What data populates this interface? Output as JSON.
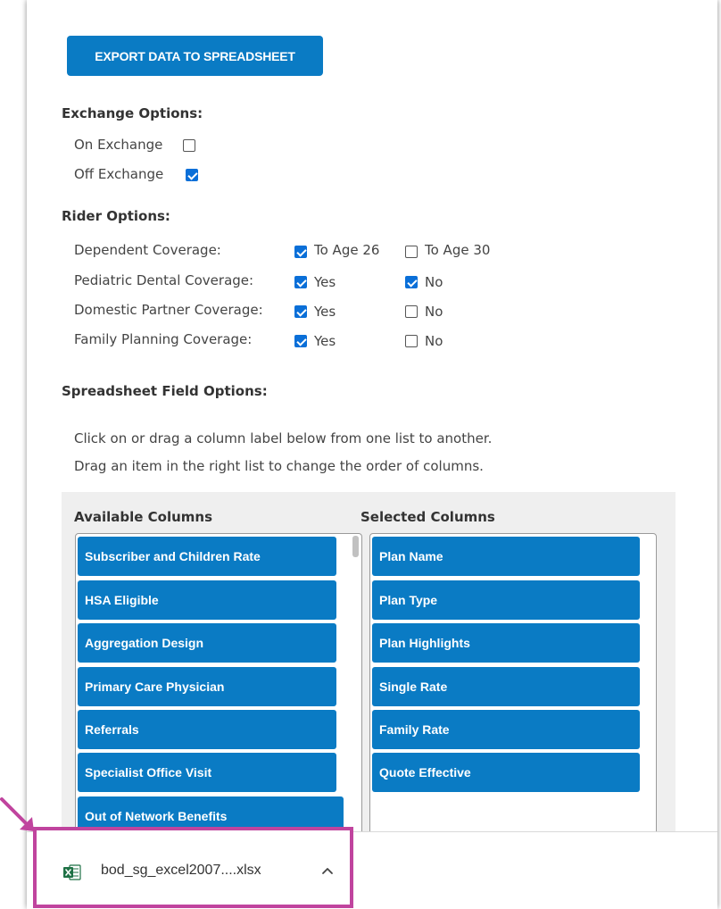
{
  "export_button": "EXPORT DATA TO SPREADSHEET",
  "exchange": {
    "heading": "Exchange Options:",
    "options": [
      {
        "label": "On Exchange",
        "checked": false
      },
      {
        "label": "Off Exchange",
        "checked": true
      }
    ]
  },
  "rider": {
    "heading": "Rider Options:",
    "rows": [
      {
        "label": "Dependent Coverage:",
        "a": "To Age 26",
        "a_checked": true,
        "b": "To Age 30",
        "b_checked": false
      },
      {
        "label": "Pediatric Dental Coverage:",
        "a": "Yes",
        "a_checked": true,
        "b": "No",
        "b_checked": true
      },
      {
        "label": "Domestic Partner Coverage:",
        "a": "Yes",
        "a_checked": true,
        "b": "No",
        "b_checked": false
      },
      {
        "label": "Family Planning Coverage:",
        "a": "Yes",
        "a_checked": true,
        "b": "No",
        "b_checked": false
      }
    ]
  },
  "fields": {
    "heading": "Spreadsheet Field Options:",
    "instructions": [
      "Click on or drag a column label below from one list to another.",
      "Drag an item in the right list to change the order of columns."
    ],
    "available_heading": "Available Columns",
    "selected_heading": "Selected Columns",
    "available": [
      "Subscriber and Children Rate",
      "HSA Eligible",
      "Aggregation Design",
      "Primary Care Physician",
      "Referrals",
      "Specialist Office Visit",
      "Out of Network Benefits"
    ],
    "selected": [
      "Plan Name",
      "Plan Type",
      "Plan Highlights",
      "Single Rate",
      "Family Rate",
      "Quote Effective"
    ]
  },
  "download": {
    "filename": "bod_sg_excel2007....xlsx",
    "icon": "excel-file-icon",
    "highlight_color": "#c0449e"
  },
  "colors": {
    "accent": "#0a7bc4",
    "checkbox": "#0a6fd8"
  }
}
